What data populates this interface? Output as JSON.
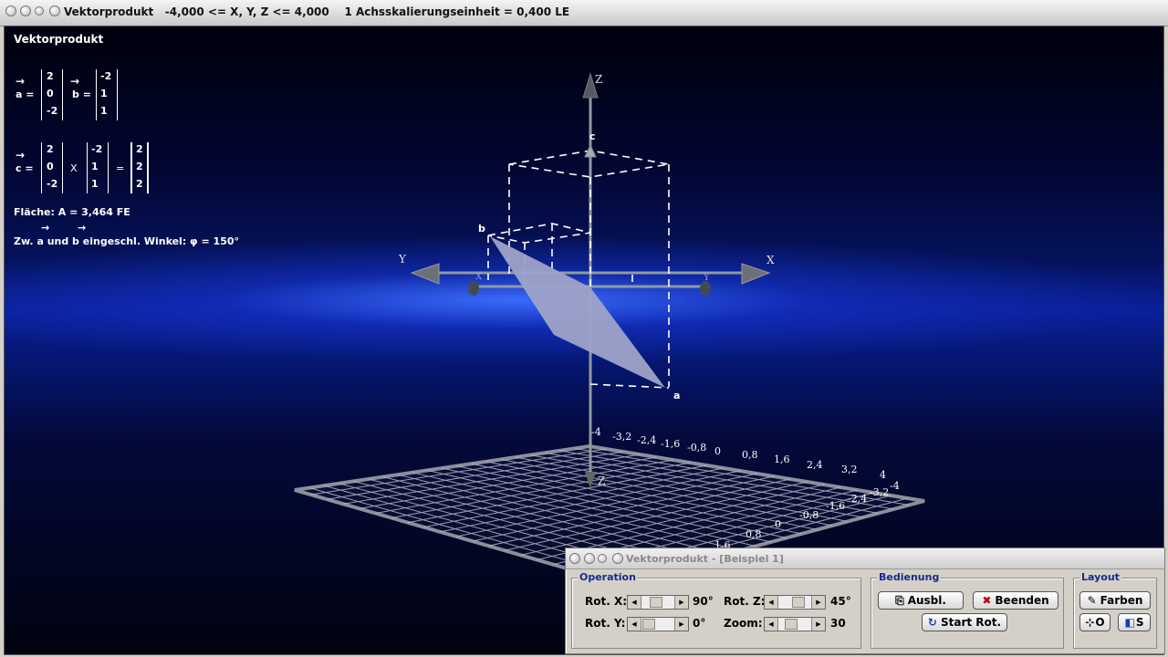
{
  "window": {
    "title": "Vektorprodukt   -4,000 <= X, Y, Z <= 4,000    1 Achsskalierungseinheit = 0,400 LE"
  },
  "info": {
    "heading": "Vektorprodukt",
    "a_label": "a =",
    "b_label": "b =",
    "c_label": "c =",
    "arrow": "→",
    "a_vec": [
      "2",
      "0",
      "-2"
    ],
    "b_vec": [
      "-2",
      "1",
      "1"
    ],
    "c_vec": [
      "2",
      "2",
      "2"
    ],
    "cross_symbol": "X",
    "equals_symbol": "=",
    "area": "Fläche: A = 3,464 FE",
    "angle": "Zw. a und b eingeschl. Winkel: φ = 150°"
  },
  "scene": {
    "axis_labels": {
      "x": "X",
      "y": "Y",
      "z": "Z",
      "z_bottom": "Z",
      "x_small": "X",
      "y_small": "Y"
    },
    "point_labels": {
      "a": "a",
      "b": "b",
      "c": "c"
    },
    "ticks_back": [
      "-4",
      "-3,2",
      "-2,4",
      "-1,6",
      "-0,8",
      "0",
      "0,8",
      "1,6",
      "2,4",
      "3,2",
      "4"
    ],
    "ticks_side": [
      "4",
      "-4",
      "-3,2",
      "-2,4",
      "-1,6",
      "-0,8",
      "0",
      "0,8",
      "1,6"
    ],
    "colors": {
      "parallelogram": "#9ea3c8",
      "axis": "#8f9aa3",
      "grid": "#b6b7c8"
    }
  },
  "panel": {
    "title": "Vektorprodukt - [Beispiel 1]",
    "operation": {
      "label": "Operation",
      "rot_x_label": "Rot. X:",
      "rot_x_value": "90°",
      "rot_y_label": "Rot. Y:",
      "rot_y_value": "0°",
      "rot_z_label": "Rot. Z:",
      "rot_z_value": "45°",
      "zoom_label": "Zoom:",
      "zoom_value": "30"
    },
    "bedienung": {
      "label": "Bedienung",
      "ausbl": "Ausbl.",
      "beenden": "Beenden",
      "start_rot": "Start Rot."
    },
    "layout": {
      "label": "Layout",
      "farben": "Farben",
      "btn_o": "O",
      "btn_s": "S"
    }
  }
}
